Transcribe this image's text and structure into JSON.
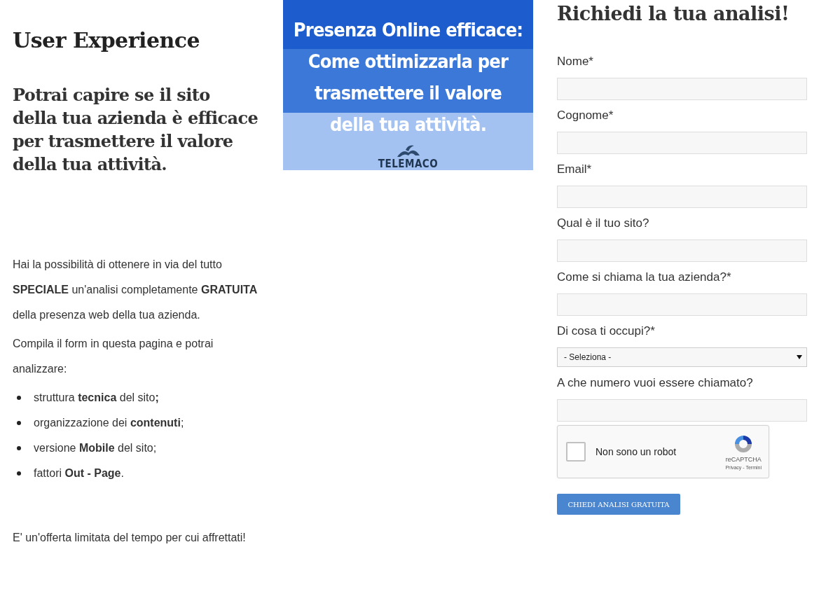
{
  "intro": {
    "title": "User Experience",
    "subtitle": "Potrai capire se il sito della tua azienda è efficace per trasmettere il valore della tua attività.",
    "paragraphs": [
      "Hai la possibilità di ottenere in via del tutto **SPECIALE** un'analisi completamente **GRATUITA** della presenza web della tua azienda.",
      "Compila il form in questa pagina e potrai analizzare:"
    ],
    "bullets": [
      "struttura **tecnica** del sito**;**",
      "organizzazione dei **contenuti**;",
      "versione **Mobile** del sito;",
      "fattori **Out - Page**."
    ],
    "closing": "E' un'offerta limitata del tempo per cui affrettati!"
  },
  "banner": {
    "lines": [
      "Presenza Online efficace:",
      "Come ottimizzarla per",
      "trasmettere il valore",
      "della tua attività."
    ],
    "logo": "TELEMACO"
  },
  "form": {
    "title": "Richiedi la tua analisi!",
    "fields": [
      {
        "kind": "text",
        "label": "Nome*"
      },
      {
        "kind": "text",
        "label": "Cognome*"
      },
      {
        "kind": "text",
        "label": "Email*"
      },
      {
        "kind": "text",
        "label": "Qual è il tuo sito?"
      },
      {
        "kind": "text",
        "label": "Come si chiama la tua azienda?*"
      },
      {
        "kind": "select",
        "label": "Di cosa ti occupi?*",
        "value": "- Seleziona -"
      },
      {
        "kind": "text",
        "label": "A che numero vuoi essere chiamato?"
      }
    ],
    "captcha": {
      "label": "Non sono un robot",
      "checked": false,
      "brand": "reCAPTCHA",
      "links": "Privacy - Termini"
    },
    "submit": "CHIEDI ANALISI GRATUITA"
  }
}
